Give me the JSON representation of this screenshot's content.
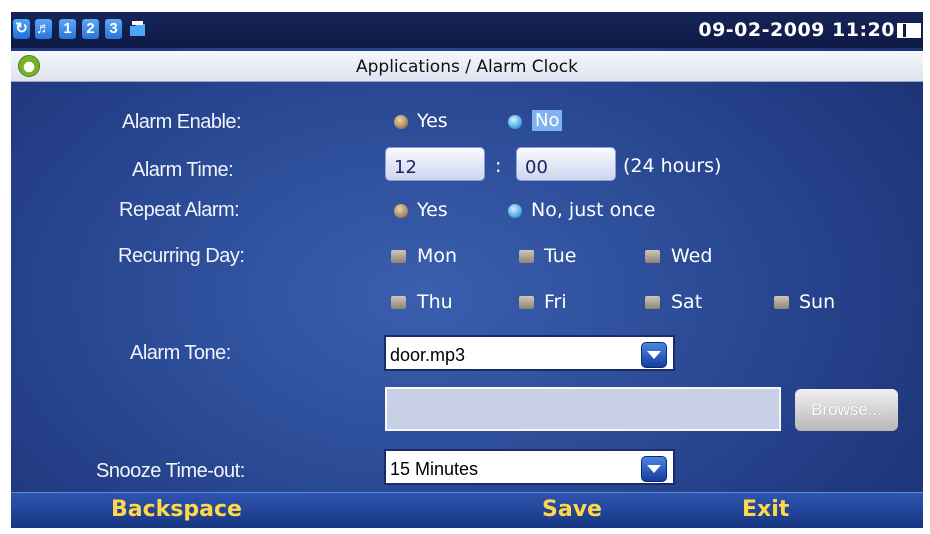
{
  "status_bar": {
    "icons": [
      "refresh-icon",
      "volume-icon"
    ],
    "lines": [
      "1",
      "2",
      "3"
    ],
    "folder_icon": "folder-icon",
    "datetime": "09-02-2009 11:20",
    "battery_icon": "battery-icon"
  },
  "title_bar": {
    "app_icon": "alarm-clock-icon",
    "title": "Applications / Alarm Clock"
  },
  "form": {
    "alarm_enable": {
      "label": "Alarm Enable:",
      "yes": "Yes",
      "no": "No",
      "selected": "No"
    },
    "alarm_time": {
      "label": "Alarm Time:",
      "hour": "12",
      "separator": ":",
      "minute": "00",
      "hint": "(24 hours)"
    },
    "repeat_alarm": {
      "label": "Repeat Alarm:",
      "yes": "Yes",
      "no": "No, just once",
      "selected": "No, just once"
    },
    "recurring_day": {
      "label": "Recurring Day:",
      "days": [
        "Mon",
        "Tue",
        "Wed",
        "Thu",
        "Fri",
        "Sat",
        "Sun"
      ]
    },
    "alarm_tone": {
      "label": "Alarm Tone:",
      "value": "door.mp3"
    },
    "browse": {
      "label": "Browse..."
    },
    "snooze": {
      "label": "Snooze Time-out:",
      "value": "15 Minutes"
    }
  },
  "bottom_bar": {
    "left": "Backspace",
    "center": "Save",
    "right": "Exit"
  }
}
